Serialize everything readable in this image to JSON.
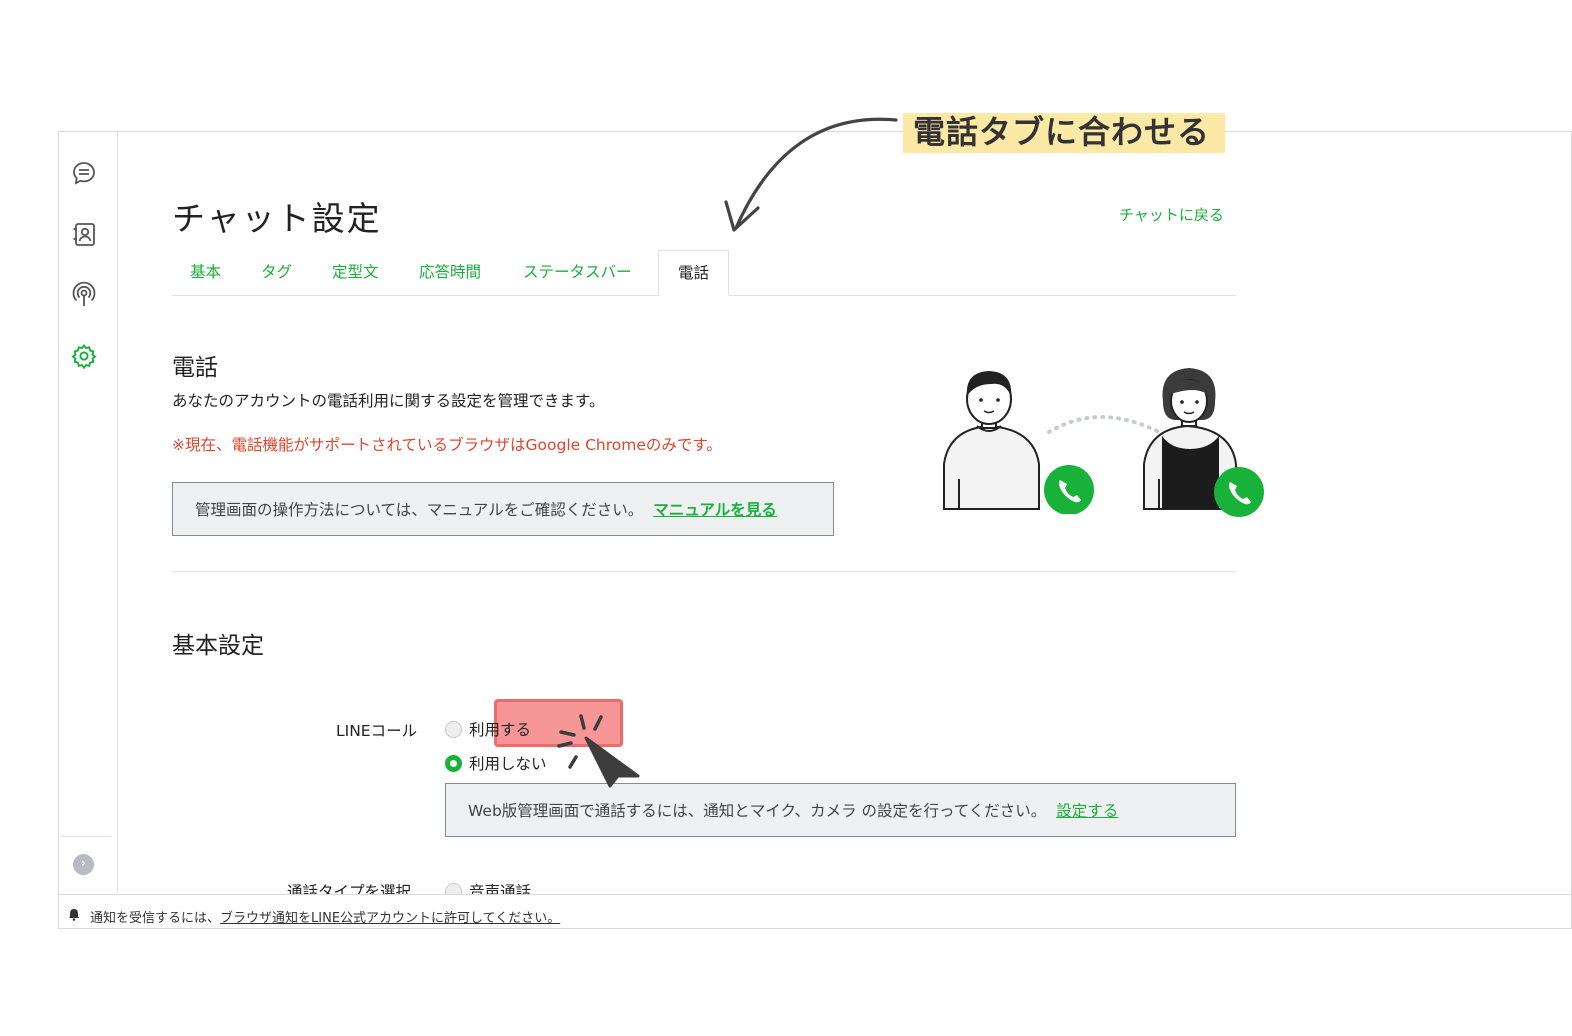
{
  "annotation": {
    "text": "電話タブに合わせる"
  },
  "page": {
    "title": "チャット設定",
    "back_link": "チャットに戻る"
  },
  "tabs": [
    {
      "label": "基本",
      "active": false
    },
    {
      "label": "タグ",
      "active": false
    },
    {
      "label": "定型文",
      "active": false
    },
    {
      "label": "応答時間",
      "active": false
    },
    {
      "label": "ステータスバー",
      "active": false
    },
    {
      "label": "電話",
      "active": true
    }
  ],
  "phone_section": {
    "title": "電話",
    "description": "あなたのアカウントの電話利用に関する設定を管理できます。",
    "warning": "※現在、電話機能がサポートされているブラウザはGoogle Chromeのみです。",
    "manual_notice": "管理画面の操作方法については、マニュアルをご確認ください。",
    "manual_link": "マニュアルを見る"
  },
  "basic_settings": {
    "title": "基本設定",
    "line_call_label": "LINEコール",
    "options": [
      {
        "label": "利用する",
        "selected": false
      },
      {
        "label": "利用しない",
        "selected": true
      }
    ],
    "web_notice": "Web版管理画面で通話するには、通知とマイク、カメラ の設定を行ってください。",
    "web_notice_link": "設定する",
    "call_type_label": "通話タイプを選択",
    "call_type_option": "音声通話"
  },
  "bottom_bar": {
    "prefix": "通知を受信するには、",
    "link": "ブラウザ通知をLINE公式アカウントに許可してください。"
  },
  "icons": {
    "sidebar": [
      "chat-icon",
      "contacts-icon",
      "broadcast-icon",
      "settings-icon"
    ],
    "expand": "chevron-right-icon",
    "bell": "bell-icon",
    "phone": "phone-icon"
  },
  "colors": {
    "accent": "#18b13a",
    "warning": "#e2452c",
    "highlight": "#ef6a6a",
    "annotation_bg": "#fde9a6"
  }
}
